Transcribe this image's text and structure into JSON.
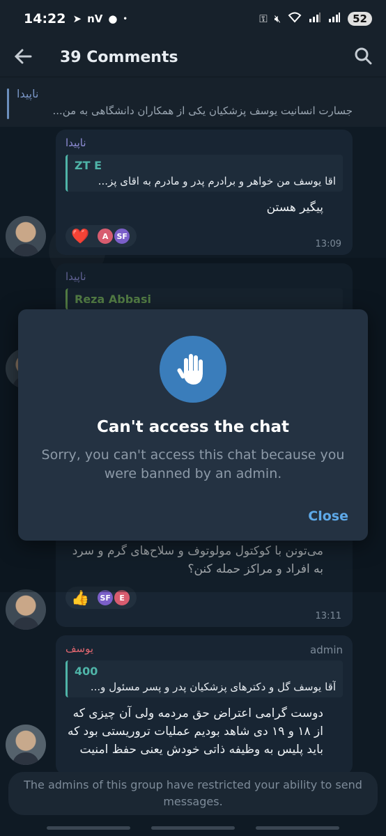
{
  "status_bar": {
    "time": "14:22",
    "left_label": "nV",
    "battery": "52"
  },
  "header": {
    "title": "39 Comments"
  },
  "pinned": {
    "name": "ناپیدا",
    "text": "جسارت انسانیت یوسف پزشکیان  یکی از همکاران دانشگاهی به من..."
  },
  "messages": [
    {
      "author": "ناپیدا",
      "quote_name": "ZT E",
      "quote_text": "اقا یوسف من  خواهر و برادرم  پدر و مادرم به اقای پز...",
      "body": "پیگیر هستن",
      "reactions": {
        "emoji": "❤️",
        "users": [
          "A",
          "SF"
        ]
      },
      "time": "13:09"
    },
    {
      "author": "ناپیدا",
      "quote_name": "Reza Abbasi"
    },
    {
      "body": "می‌تونن با کوکتول مولوتوف و سلاح‌های گرم و سرد به افراد و مراکز حمله کنن؟",
      "reactions": {
        "emoji": "👍",
        "users": [
          "SF",
          "E"
        ]
      },
      "time": "13:11"
    },
    {
      "author": "یوسف",
      "admin_tag": "admin",
      "quote_name": "400",
      "quote_text": "آقا یوسف گل و دکترهای پزشکیان پدر و پسر مسئول و...",
      "body": "دوست گرامی اعتراض حق مردمه ولی آن چیزی که از ۱۸ و ۱۹ دی شاهد بودیم عملیات تروریستی بود که باید پلیس به وظیفه ذاتی خودش یعنی حفظ امنیت عمل می کرد"
    }
  ],
  "dialog": {
    "title": "Can't access the chat",
    "text": "Sorry, you can't access this chat because you were banned by an admin.",
    "close_label": "Close"
  },
  "restriction_text": "The admins of this group have restricted your ability to send messages.",
  "colors": {
    "accent": "#5ea9e8",
    "dialog_icon_bg": "#3a7dbb",
    "bubble": "#182533",
    "quote_accent": "#4fb4a8"
  }
}
